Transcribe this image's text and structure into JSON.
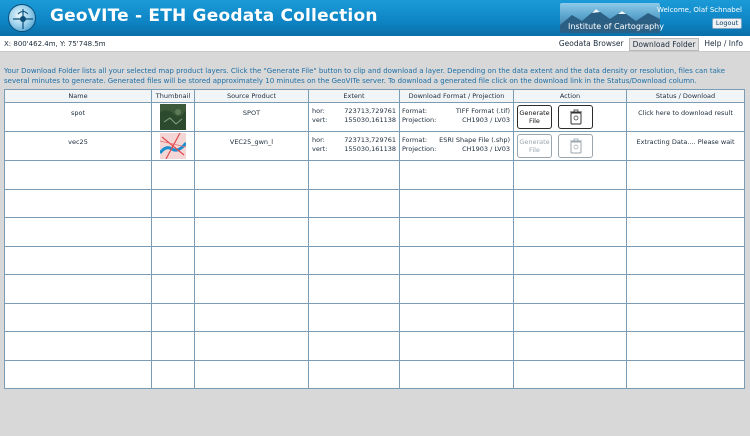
{
  "header": {
    "app_title": "GeoVITe - ETH Geodata Collection",
    "institute": "Institute of Cartography",
    "welcome": "Welcome, Olaf Schnabel",
    "logout_label": "Logout"
  },
  "navbar": {
    "coordinates": "X: 800'462.4m, Y: 75'748.5m",
    "tabs": [
      {
        "label": "Geodata Browser",
        "active": false
      },
      {
        "label": "Download Folder",
        "active": true
      },
      {
        "label": "Help / Info",
        "active": false
      }
    ]
  },
  "intro": "Your Download Folder lists all your selected map product layers. Click the \"Generate File\" button to clip and download a layer. Depending on the data extent and the data density or resolution, files can take several minutes to generate. Generated files will be stored approximately 10 minutes on the GeoVITe server. To download a generated file click on the download link in the Status/Download column.",
  "table": {
    "columns": [
      "Name",
      "Thumbnail",
      "Source Product",
      "Extent",
      "Download Format / Projection",
      "Action",
      "Status / Download"
    ],
    "rows": [
      {
        "name": "spot",
        "source_product": "SPOT",
        "extent": {
          "hor_label": "hor:",
          "hor_value": "723713,729761",
          "vert_label": "vert:",
          "vert_value": "155030,161138"
        },
        "format": {
          "format_label": "Format:",
          "format_value": "TIFF Format (.tif)",
          "projection_label": "Projection:",
          "projection_value": "CH1903 / LV03"
        },
        "generate_label": "Generate File",
        "generate_enabled": true,
        "status": "Click here to download result"
      },
      {
        "name": "vec25",
        "source_product": "VEC25_gwn_l",
        "extent": {
          "hor_label": "hor:",
          "hor_value": "723713,729761",
          "vert_label": "vert:",
          "vert_value": "155030,161138"
        },
        "format": {
          "format_label": "Format:",
          "format_value": "ESRI Shape File (.shp)",
          "projection_label": "Projection:",
          "projection_value": "CH1903 / LV03"
        },
        "generate_label": "Generate File",
        "generate_enabled": false,
        "status": "Extracting Data.... Please wait"
      }
    ],
    "empty_rows": 8
  },
  "colors": {
    "header_blue": "#0e84c4",
    "intro_text": "#1e6fa6",
    "table_border": "#7a9db5",
    "background": "#d8d8d8"
  },
  "icons": {
    "logo": "globe-logo-icon",
    "trash": "trash-bin-icon"
  }
}
